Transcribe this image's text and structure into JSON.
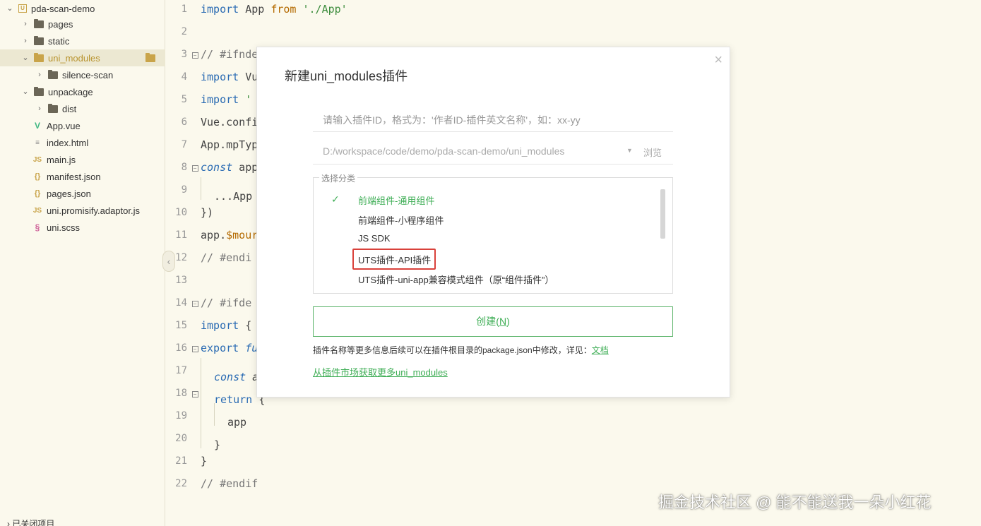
{
  "sidebar": {
    "items": [
      {
        "label": "pda-scan-demo",
        "type": "project",
        "expanded": true,
        "level": 0
      },
      {
        "label": "pages",
        "type": "folder",
        "expanded": false,
        "level": 1
      },
      {
        "label": "static",
        "type": "folder",
        "expanded": false,
        "level": 1
      },
      {
        "label": "uni_modules",
        "type": "folder",
        "expanded": true,
        "level": 1,
        "selected": true
      },
      {
        "label": "silence-scan",
        "type": "folder",
        "expanded": false,
        "level": 2
      },
      {
        "label": "unpackage",
        "type": "folder",
        "expanded": true,
        "level": 1
      },
      {
        "label": "dist",
        "type": "folder",
        "expanded": false,
        "level": 2
      },
      {
        "label": "App.vue",
        "type": "vue",
        "level": 1
      },
      {
        "label": "index.html",
        "type": "html",
        "level": 1
      },
      {
        "label": "main.js",
        "type": "js",
        "level": 1
      },
      {
        "label": "manifest.json",
        "type": "json",
        "level": 1
      },
      {
        "label": "pages.json",
        "type": "json",
        "level": 1
      },
      {
        "label": "uni.promisify.adaptor.js",
        "type": "js",
        "level": 1
      },
      {
        "label": "uni.scss",
        "type": "scss",
        "level": 1
      }
    ],
    "icon_labels": {
      "js": "JS",
      "json": "{}",
      "vue": "V",
      "html": "≡",
      "scss": "§"
    },
    "closed_projects_label": "已关闭项目"
  },
  "editor": {
    "lines": [
      {
        "n": "1",
        "fold": false
      },
      {
        "n": "2",
        "fold": false
      },
      {
        "n": "3",
        "fold": true
      },
      {
        "n": "4",
        "fold": false
      },
      {
        "n": "5",
        "fold": false
      },
      {
        "n": "6",
        "fold": false
      },
      {
        "n": "7",
        "fold": false
      },
      {
        "n": "8",
        "fold": true
      },
      {
        "n": "9",
        "fold": false
      },
      {
        "n": "10",
        "fold": false
      },
      {
        "n": "11",
        "fold": false
      },
      {
        "n": "12",
        "fold": false
      },
      {
        "n": "13",
        "fold": false
      },
      {
        "n": "14",
        "fold": true
      },
      {
        "n": "15",
        "fold": false
      },
      {
        "n": "16",
        "fold": true
      },
      {
        "n": "17",
        "fold": false
      },
      {
        "n": "18",
        "fold": true
      },
      {
        "n": "19",
        "fold": false
      },
      {
        "n": "20",
        "fold": false
      },
      {
        "n": "21",
        "fold": false
      },
      {
        "n": "22",
        "fold": false
      }
    ],
    "code": {
      "l1": [
        "import",
        " App ",
        "from",
        " './App'"
      ],
      "l3": "// #ifnde",
      "l4": [
        "import",
        " Vu"
      ],
      "l5": [
        "import",
        " '"
      ],
      "l6": "Vue.confi",
      "l7": "App.mpTyp",
      "l8": [
        "const",
        " app"
      ],
      "l9": "...App",
      "l10": "})",
      "l11": [
        "app.",
        "$mour"
      ],
      "l12": "// #endi",
      "l14": "// #ifde",
      "l15": [
        "import",
        " {"
      ],
      "l16": [
        "export",
        " fu"
      ],
      "l17": [
        "const",
        " a"
      ],
      "l18": [
        "return",
        " {"
      ],
      "l19": "app",
      "l20": "}",
      "l21": "}",
      "l22": "// #endif"
    }
  },
  "modal": {
    "title": "新建uni_modules插件",
    "close_glyph": "×",
    "plugin_id_placeholder": "请输入插件ID，格式为：'作者ID-插件英文名称'，如：xx-yy",
    "plugin_id_value": "",
    "path_value": "D:/workspace/code/demo/pda-scan-demo/uni_modules",
    "path_arrow": "▼",
    "browse_label": "浏览",
    "category_legend": "选择分类",
    "check_glyph": "✓",
    "categories": [
      {
        "label": "前端组件-通用组件",
        "selected": true
      },
      {
        "label": "前端组件-小程序组件",
        "selected": false
      },
      {
        "label": "JS SDK",
        "selected": false
      },
      {
        "label": "UTS插件-API插件",
        "selected": false,
        "highlighted": true
      },
      {
        "label": "UTS插件-uni-app兼容模式组件（原“组件插件”）",
        "selected": false
      }
    ],
    "create_button": {
      "label": "创建(",
      "accel": "N",
      "tail": ")"
    },
    "info_text": "插件名称等更多信息后续可以在插件根目录的package.json中修改，详见：",
    "info_link": "文档",
    "market_link": "从插件市场获取更多uni_modules"
  },
  "watermark": "掘金技术社区 @ 能不能送我一朵小红花",
  "colors": {
    "accent": "#3fae56",
    "highlight_border": "#d9413b",
    "folder_selected": "#c9a44a"
  }
}
